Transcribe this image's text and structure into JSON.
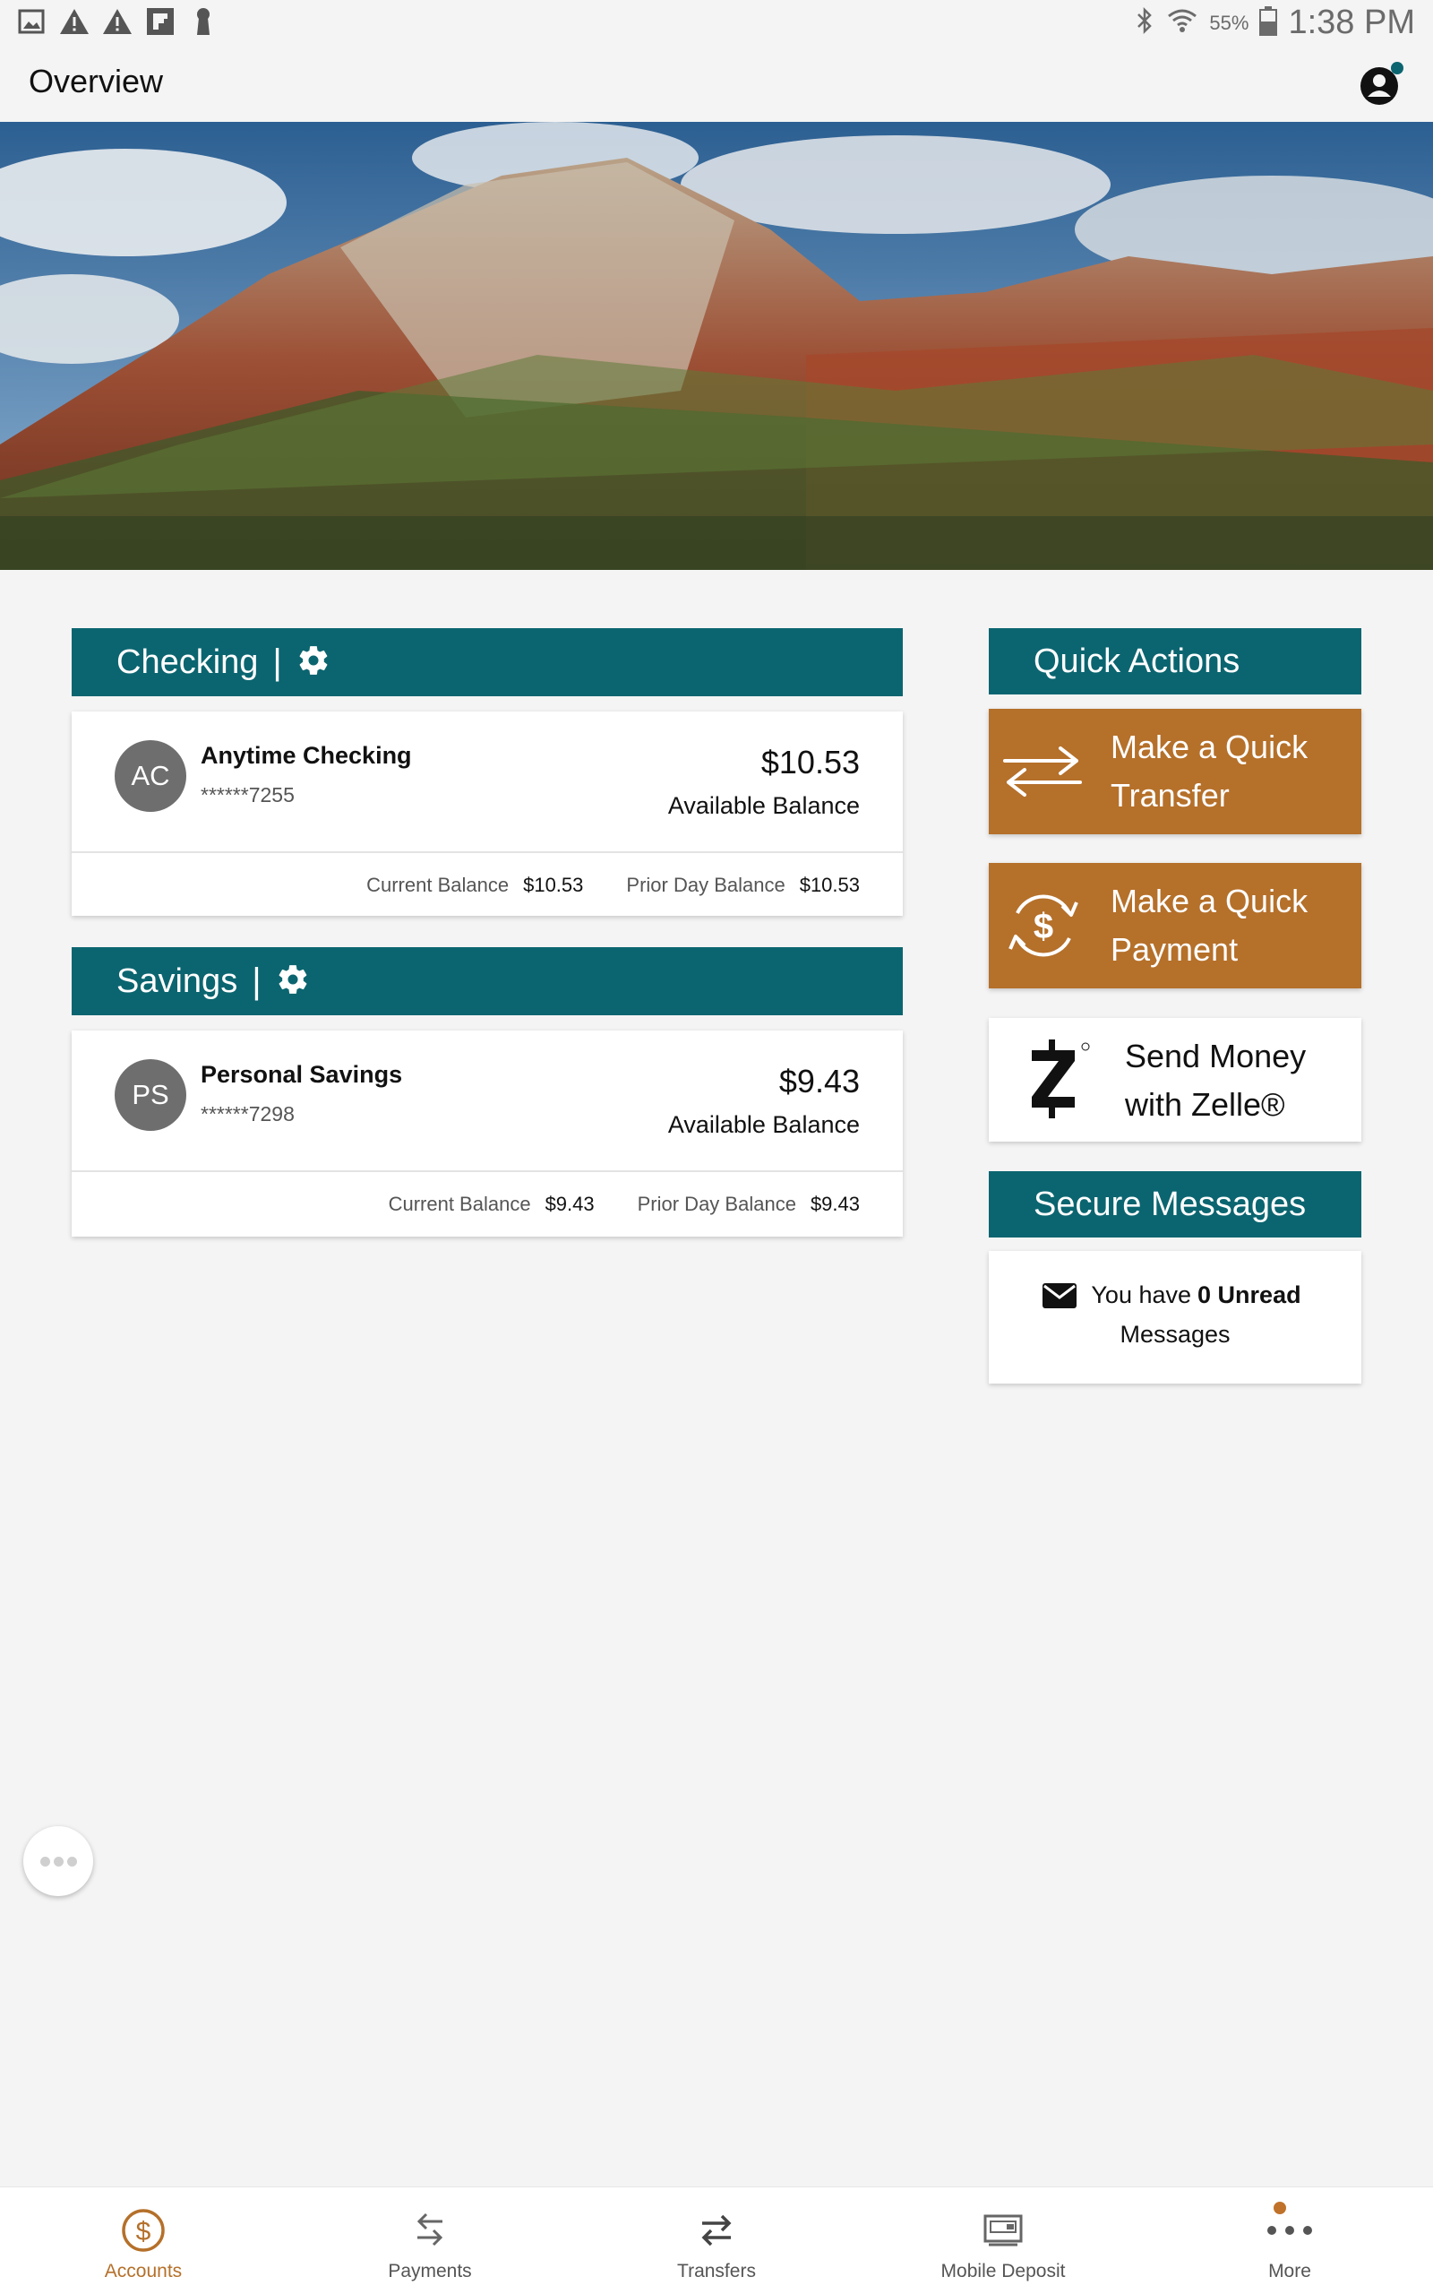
{
  "status_bar": {
    "battery_percent": "55%",
    "time": "1:38 PM",
    "left_icons": [
      "gallery-icon",
      "warning-icon",
      "warning-icon",
      "flipboard-icon",
      "keyhole-icon"
    ],
    "right_icons": [
      "bluetooth-icon",
      "wifi-icon",
      "battery-icon"
    ]
  },
  "header": {
    "title": "Overview"
  },
  "checking": {
    "section_label": "Checking",
    "pipe": "|",
    "account": {
      "initials": "AC",
      "name": "Anytime Checking",
      "masked_number": "******7255",
      "balance": "$10.53",
      "balance_label": "Available Balance",
      "current_label": "Current Balance",
      "current_value": "$10.53",
      "prior_label": "Prior Day Balance",
      "prior_value": "$10.53"
    }
  },
  "savings": {
    "section_label": "Savings",
    "pipe": "|",
    "account": {
      "initials": "PS",
      "name": "Personal Savings",
      "masked_number": "******7298",
      "balance": "$9.43",
      "balance_label": "Available Balance",
      "current_label": "Current Balance",
      "current_value": "$9.43",
      "prior_label": "Prior Day Balance",
      "prior_value": "$9.43"
    }
  },
  "quick_actions": {
    "title": "Quick Actions",
    "transfer": {
      "line1": "Make a Quick",
      "line2": "Transfer"
    },
    "payment": {
      "line1": "Make a Quick",
      "line2": "Payment"
    },
    "zelle": {
      "line1": "Send Money",
      "line2": "with Zelle®"
    }
  },
  "secure_messages": {
    "title": "Secure Messages",
    "prefix": "You have",
    "count_text": "0 Unread",
    "suffix": "Messages"
  },
  "bottom_nav": {
    "items": [
      {
        "label": "Accounts",
        "icon": "dollar-circle-icon"
      },
      {
        "label": "Payments",
        "icon": "payments-arrows-icon"
      },
      {
        "label": "Transfers",
        "icon": "transfer-arrows-icon"
      },
      {
        "label": "Mobile Deposit",
        "icon": "check-deposit-icon"
      },
      {
        "label": "More",
        "icon": "more-dots-icon"
      }
    ]
  },
  "colors": {
    "teal": "#0b6570",
    "accent": "#b5702a",
    "background": "#f4f4f4"
  }
}
